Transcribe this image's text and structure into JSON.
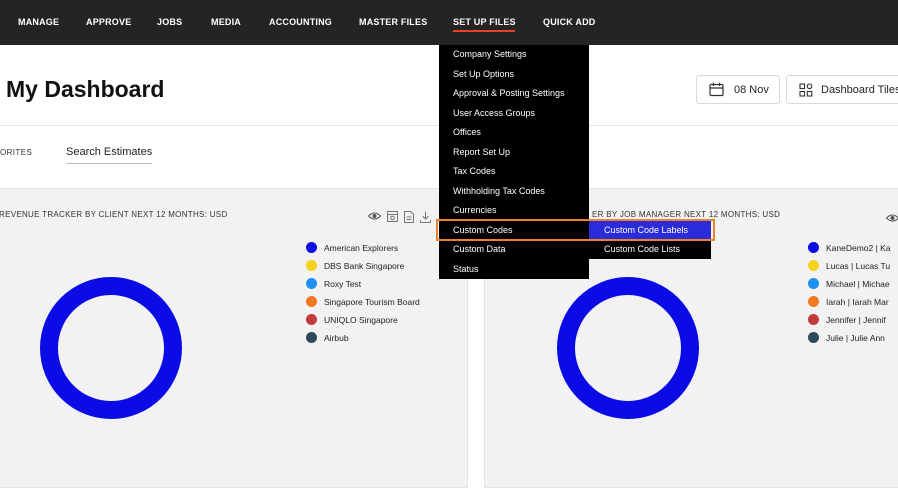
{
  "nav": {
    "items": [
      "MANAGE",
      "APPROVE",
      "JOBS",
      "MEDIA",
      "ACCOUNTING",
      "MASTER FILES",
      "SET UP FILES",
      "QUICK ADD"
    ],
    "active": "SET UP FILES"
  },
  "header": {
    "title": "My Dashboard",
    "date_label": "08 Nov",
    "tiles_label": "Dashboard Tiles"
  },
  "tabs": {
    "favorites": "ORITES",
    "search": "Search Estimates"
  },
  "panels": [
    {
      "title": "REVENUE TRACKER BY CLIENT NEXT 12 MONTHS: USD",
      "legend": [
        {
          "label": "American Explorers",
          "color": "#0b0be6"
        },
        {
          "label": "DBS Bank Singapore",
          "color": "#f6d21c"
        },
        {
          "label": "Roxy Test",
          "color": "#1e90f2"
        },
        {
          "label": "Singapore Tourism Board",
          "color": "#f07922"
        },
        {
          "label": "UNIQLO Singapore",
          "color": "#c23b3b"
        },
        {
          "label": "Airbub",
          "color": "#2e4a5a"
        }
      ]
    },
    {
      "title": "ER BY JOB MANAGER NEXT 12 MONTHS: USD",
      "legend": [
        {
          "label": "KaneDemo2 | Ka",
          "color": "#0b0be6"
        },
        {
          "label": "Lucas | Lucas Tu",
          "color": "#f6d21c"
        },
        {
          "label": "Michael | Michae",
          "color": "#1e90f2"
        },
        {
          "label": "Iarah | Iarah Mar",
          "color": "#f07922"
        },
        {
          "label": "Jennifer | Jennif",
          "color": "#c23b3b"
        },
        {
          "label": "Julie | Julie Ann",
          "color": "#2e4a5a"
        }
      ]
    }
  ],
  "dropdown": {
    "items": [
      "Company Settings",
      "Set Up Options",
      "Approval & Posting Settings",
      "User Access Groups",
      "Offices",
      "Report Set Up",
      "Tax Codes",
      "Withholding Tax Codes",
      "Currencies",
      "Custom Codes",
      "Custom Data",
      "Status"
    ],
    "submenu": [
      "Custom Code Labels",
      "Custom Code Lists"
    ],
    "submenu_active": "Custom Code Labels"
  },
  "colors": {
    "nav_bg": "#242424",
    "donut": "#0b0be6",
    "highlight": "#e8852b",
    "submenu_active": "#2b2bd9"
  }
}
